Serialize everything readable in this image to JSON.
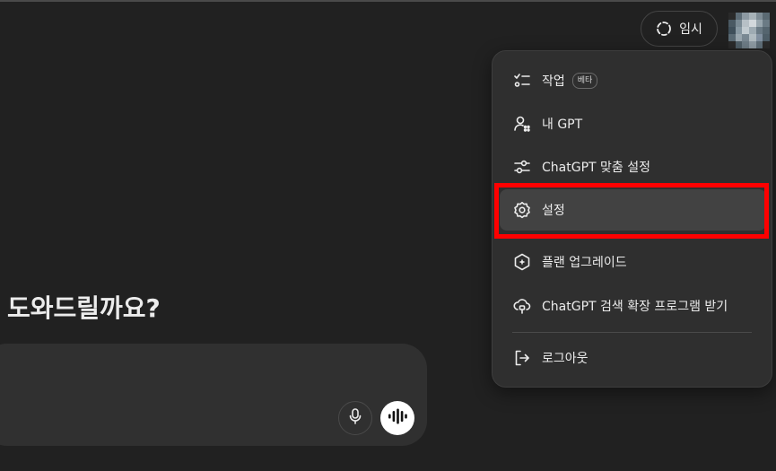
{
  "header": {
    "temporary_label": "임시"
  },
  "main": {
    "greeting": "도와드릴까요?"
  },
  "menu": {
    "items": [
      {
        "label": "작업",
        "badge": "베타",
        "icon": "tasks-icon"
      },
      {
        "label": "내 GPT",
        "icon": "my-gpts-icon"
      },
      {
        "label": "ChatGPT 맞춤 설정",
        "icon": "customize-sliders-icon"
      },
      {
        "label": "설정",
        "icon": "gear-icon"
      },
      {
        "label": "플랜 업그레이드",
        "icon": "upgrade-plan-icon"
      },
      {
        "label": "ChatGPT 검색 확장 프로그램 받기",
        "icon": "extension-plug-icon"
      },
      {
        "label": "로그아웃",
        "icon": "logout-icon"
      }
    ]
  },
  "colors": {
    "background": "#212121",
    "menu_background": "#2f2f2f",
    "active_item": "#424242",
    "highlight": "#ff0000"
  }
}
